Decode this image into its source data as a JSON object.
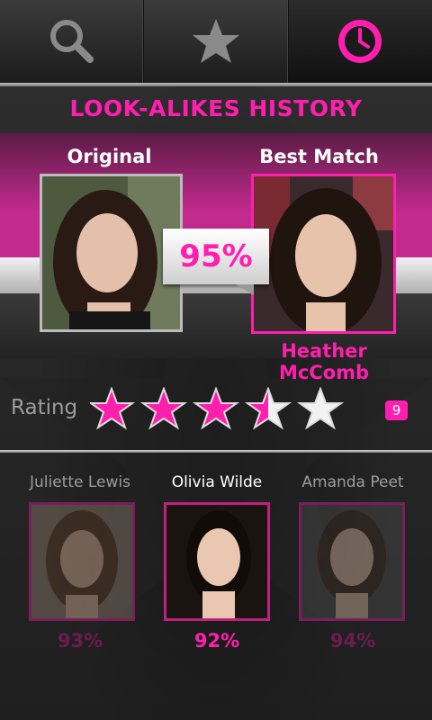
{
  "tabs": [
    {
      "icon": "search-icon",
      "active": false
    },
    {
      "icon": "star-icon",
      "active": false
    },
    {
      "icon": "clock-icon",
      "active": true
    }
  ],
  "title": "LOOK-ALIKES HISTORY",
  "comparison": {
    "original_label": "Original",
    "best_label": "Best Match",
    "match_percent": "95%",
    "match_name": "Heather McComb"
  },
  "rating": {
    "label": "Rating",
    "stars": 3.5,
    "max": 5,
    "count": "9"
  },
  "candidates": [
    {
      "name": "Juliette Lewis",
      "percent": "93%",
      "selected": false
    },
    {
      "name": "Olivia Wilde",
      "percent": "92%",
      "selected": true
    },
    {
      "name": "Amanda Peet",
      "percent": "94%",
      "selected": false
    }
  ],
  "colors": {
    "accent": "#ff1fae",
    "band": "#c22a8e"
  }
}
